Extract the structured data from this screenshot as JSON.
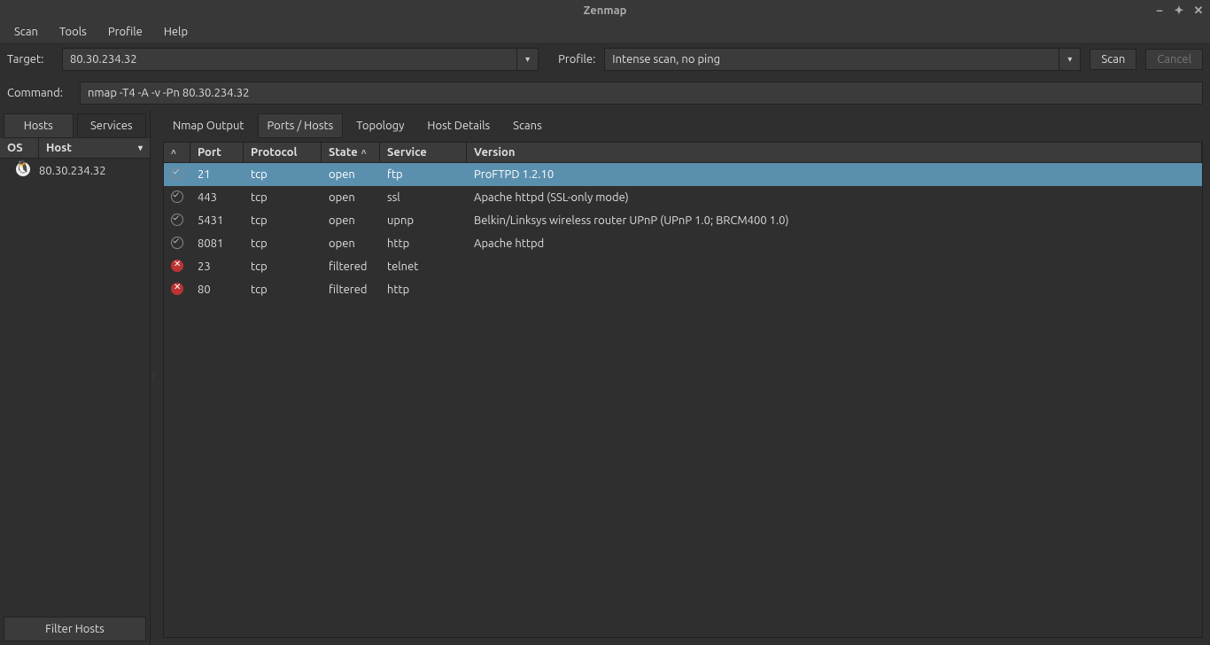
{
  "window": {
    "title": "Zenmap"
  },
  "menubar": [
    "Scan",
    "Tools",
    "Profile",
    "Help"
  ],
  "toolbar": {
    "target_label": "Target:",
    "target_value": "80.30.234.32",
    "profile_label": "Profile:",
    "profile_value": "Intense scan, no ping",
    "scan_label": "Scan",
    "cancel_label": "Cancel",
    "command_label": "Command:",
    "command_value": "nmap -T4 -A -v -Pn 80.30.234.32"
  },
  "left": {
    "tabs": [
      "Hosts",
      "Services"
    ],
    "active_tab": 0,
    "headers": {
      "os": "OS",
      "host": "Host"
    },
    "hosts": [
      {
        "os_icon": "linux",
        "ip": "80.30.234.32"
      }
    ],
    "filter_label": "Filter Hosts"
  },
  "right": {
    "tabs": [
      "Nmap Output",
      "Ports / Hosts",
      "Topology",
      "Host Details",
      "Scans"
    ],
    "active_tab": 1,
    "columns": [
      "",
      "Port",
      "Protocol",
      "State",
      "Service",
      "Version"
    ],
    "sort_col": 3,
    "rows": [
      {
        "status": "open",
        "port": "21",
        "protocol": "tcp",
        "state": "open",
        "service": "ftp",
        "version": "ProFTPD 1.2.10",
        "selected": true
      },
      {
        "status": "open",
        "port": "443",
        "protocol": "tcp",
        "state": "open",
        "service": "ssl",
        "version": "Apache httpd (SSL-only mode)"
      },
      {
        "status": "open",
        "port": "5431",
        "protocol": "tcp",
        "state": "open",
        "service": "upnp",
        "version": "Belkin/Linksys wireless router UPnP (UPnP 1.0; BRCM400 1.0)"
      },
      {
        "status": "open",
        "port": "8081",
        "protocol": "tcp",
        "state": "open",
        "service": "http",
        "version": "Apache httpd"
      },
      {
        "status": "filtered",
        "port": "23",
        "protocol": "tcp",
        "state": "filtered",
        "service": "telnet",
        "version": ""
      },
      {
        "status": "filtered",
        "port": "80",
        "protocol": "tcp",
        "state": "filtered",
        "service": "http",
        "version": ""
      }
    ]
  }
}
